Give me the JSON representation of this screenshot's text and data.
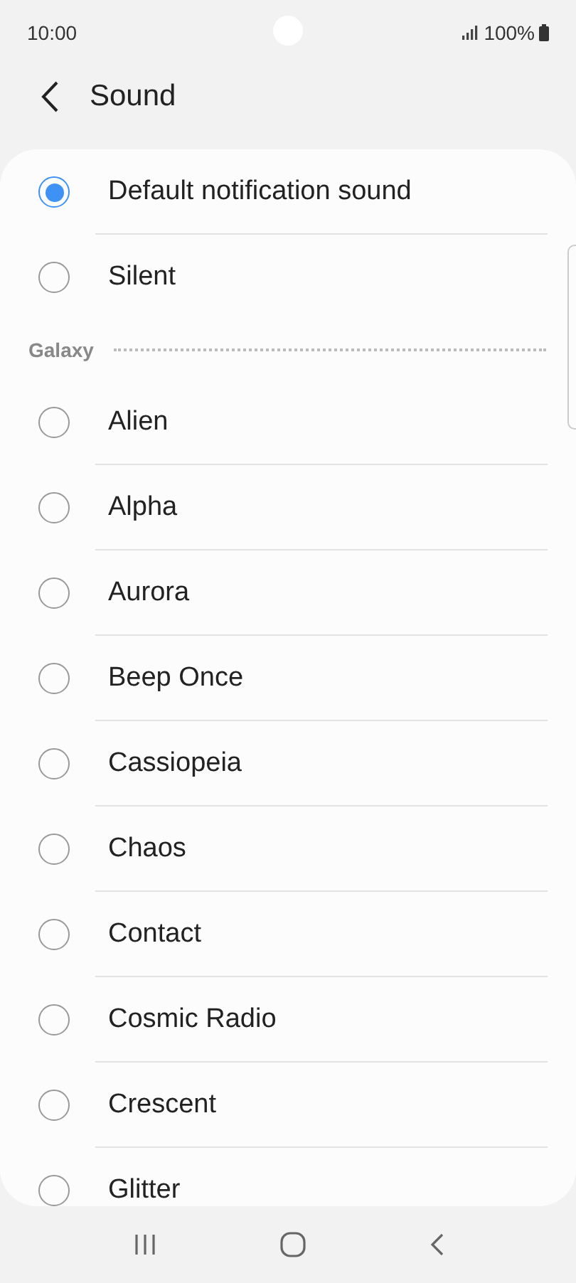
{
  "status_bar": {
    "time": "10:00",
    "battery": "100%"
  },
  "header": {
    "title": "Sound"
  },
  "top_options": [
    {
      "label": "Default notification sound",
      "selected": true
    },
    {
      "label": "Silent",
      "selected": false
    }
  ],
  "section": {
    "title": "Galaxy"
  },
  "sounds": [
    {
      "label": "Alien",
      "selected": false
    },
    {
      "label": "Alpha",
      "selected": false
    },
    {
      "label": "Aurora",
      "selected": false
    },
    {
      "label": "Beep Once",
      "selected": false
    },
    {
      "label": "Cassiopeia",
      "selected": false
    },
    {
      "label": "Chaos",
      "selected": false
    },
    {
      "label": "Contact",
      "selected": false
    },
    {
      "label": "Cosmic Radio",
      "selected": false
    },
    {
      "label": "Crescent",
      "selected": false
    },
    {
      "label": "Glitter",
      "selected": false
    }
  ]
}
